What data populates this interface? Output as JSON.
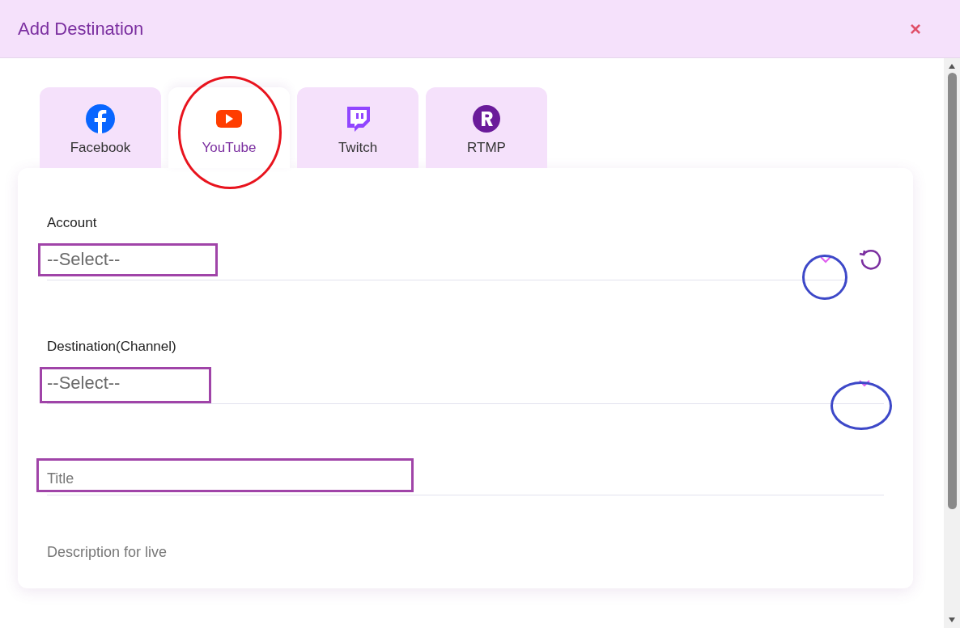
{
  "dialog": {
    "title": "Add Destination",
    "close": "×"
  },
  "tabs": [
    {
      "label": "Facebook",
      "kind": "facebook",
      "selected": false
    },
    {
      "label": "YouTube",
      "kind": "youtube",
      "selected": true
    },
    {
      "label": "Twitch",
      "kind": "twitch",
      "selected": false
    },
    {
      "label": "RTMP",
      "kind": "rtmp",
      "selected": false
    }
  ],
  "form": {
    "account": {
      "label": "Account",
      "value": "--Select--"
    },
    "destination": {
      "label": "Destination(Channel)",
      "value": "--Select--"
    },
    "title": {
      "placeholder": "Title"
    },
    "description": {
      "placeholder": "Description for live"
    }
  }
}
